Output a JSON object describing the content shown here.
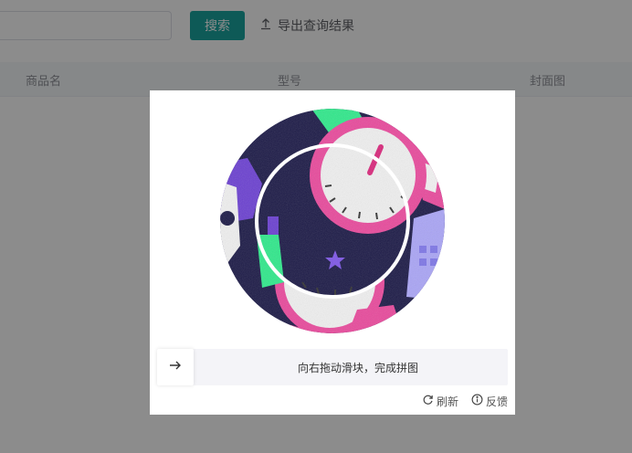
{
  "toolbar": {
    "search_button": "搜索",
    "export_label": "导出查询结果"
  },
  "table": {
    "columns": [
      "商品名",
      "型号",
      "封面图"
    ]
  },
  "captcha": {
    "slider_hint": "向右拖动滑块，完成拼图",
    "refresh_label": "刷新",
    "feedback_label": "反馈"
  }
}
